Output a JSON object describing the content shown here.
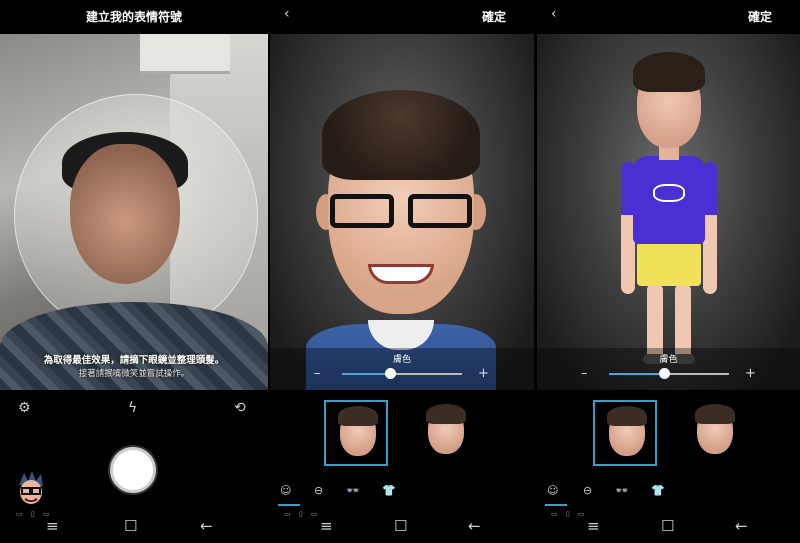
{
  "panels": {
    "capture": {
      "title": "建立我的表情符號",
      "hint_primary": "為取得最佳效果，請摘下眼鏡並整理頭髮。",
      "hint_secondary": "接著請抿嘴微笑並嘗試操作。",
      "tools": [
        "gear-icon",
        "flash-off-icon",
        "switch-camera-icon"
      ]
    },
    "head_editor": {
      "confirm_label": "確定",
      "slider_label": "膚色",
      "slider_value": 0.4
    },
    "body_editor": {
      "confirm_label": "確定",
      "slider_label": "膚色",
      "slider_value": 0.46
    }
  },
  "icons": {
    "back": "‹",
    "minus": "–",
    "plus": "+",
    "gear": "⚙",
    "flash_off": "ϟ",
    "switch_camera": "⟲",
    "glasses": "👓",
    "shirt": "👕",
    "nav_recent": "≡",
    "nav_home": "☐",
    "nav_back": "←"
  },
  "colors": {
    "accent": "#2ea0d2",
    "background": "#000000"
  }
}
